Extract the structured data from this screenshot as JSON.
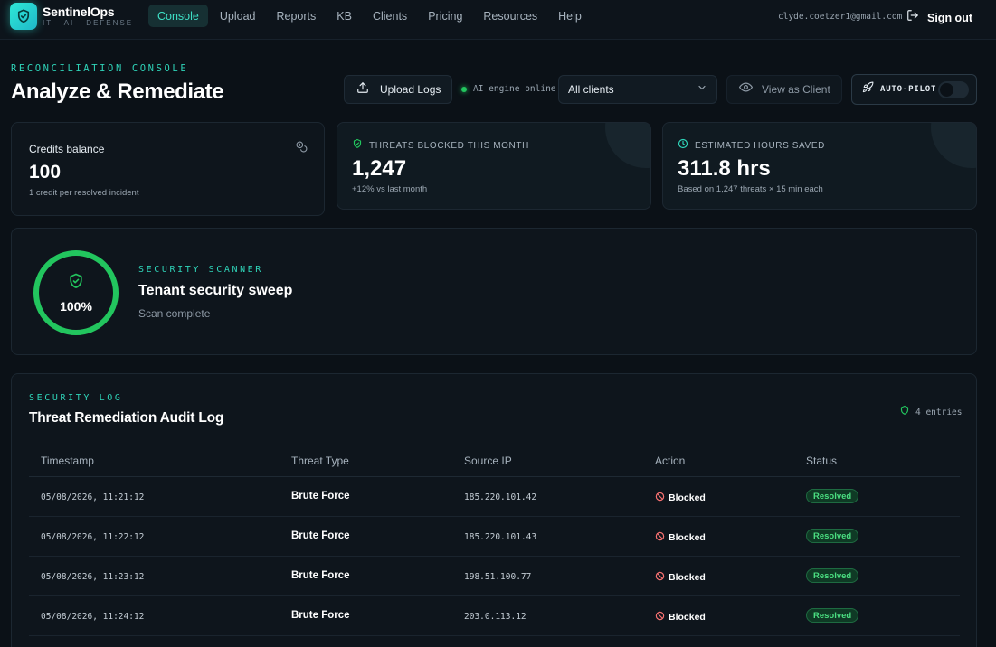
{
  "brand": {
    "name": "SentinelOps",
    "tagline": "IT · AI · DEFENSE"
  },
  "nav": {
    "items": [
      {
        "label": "Console",
        "active": true
      },
      {
        "label": "Upload",
        "active": false
      },
      {
        "label": "Reports",
        "active": false
      },
      {
        "label": "KB",
        "active": false
      },
      {
        "label": "Clients",
        "active": false
      },
      {
        "label": "Pricing",
        "active": false
      },
      {
        "label": "Resources",
        "active": false
      },
      {
        "label": "Help",
        "active": false
      }
    ]
  },
  "user": {
    "email": "clyde.coetzer1@gmail.com",
    "sign_out": "Sign out"
  },
  "header": {
    "eyebrow": "RECONCILIATION CONSOLE",
    "title": "Analyze & Remediate",
    "upload_label": "Upload Logs",
    "engine_status": "AI engine online",
    "client_select": "All clients",
    "view_as_client": "View as Client",
    "autopilot_label": "AUTO-PILOT",
    "autopilot_on": false
  },
  "stats": {
    "credits": {
      "label": "Credits balance",
      "value": "100",
      "note": "1 credit per resolved incident"
    },
    "threats": {
      "label": "THREATS BLOCKED THIS MONTH",
      "value": "1,247",
      "note": "+12% vs last month"
    },
    "hours": {
      "label": "ESTIMATED HOURS SAVED",
      "value": "311.8 hrs",
      "note": "Based on 1,247 threats × 15 min each"
    }
  },
  "scanner": {
    "eyebrow": "SECURITY SCANNER",
    "title": "Tenant security sweep",
    "status": "Scan complete",
    "progress_label": "100%",
    "progress": 1.0
  },
  "log": {
    "eyebrow": "SECURITY LOG",
    "title": "Threat Remediation Audit Log",
    "count_label": "4 entries",
    "columns": [
      "Timestamp",
      "Threat Type",
      "Source IP",
      "Action",
      "Status"
    ],
    "rows": [
      {
        "timestamp": "05/08/2026, 11:21:12",
        "type": "Brute Force",
        "ip": "185.220.101.42",
        "action": "Blocked",
        "status": "Resolved"
      },
      {
        "timestamp": "05/08/2026, 11:22:12",
        "type": "Brute Force",
        "ip": "185.220.101.43",
        "action": "Blocked",
        "status": "Resolved"
      },
      {
        "timestamp": "05/08/2026, 11:23:12",
        "type": "Brute Force",
        "ip": "198.51.100.77",
        "action": "Blocked",
        "status": "Resolved"
      },
      {
        "timestamp": "05/08/2026, 11:24:12",
        "type": "Brute Force",
        "ip": "203.0.113.12",
        "action": "Blocked",
        "status": "Resolved"
      }
    ]
  },
  "colors": {
    "accent": "#2fd3b8",
    "success": "#22c55e",
    "danger": "#f87171",
    "background": "#0b1117"
  },
  "icons": {
    "logo": "shield-icon",
    "sign_out": "logout-icon",
    "upload": "upload-icon",
    "select": "chevron-down-icon",
    "view": "eye-icon",
    "autopilot": "rocket-icon",
    "credits": "coins-icon",
    "threats": "shield-check-icon",
    "hours": "clock-icon",
    "scanner": "shield-check-icon",
    "action": "ban-icon"
  }
}
